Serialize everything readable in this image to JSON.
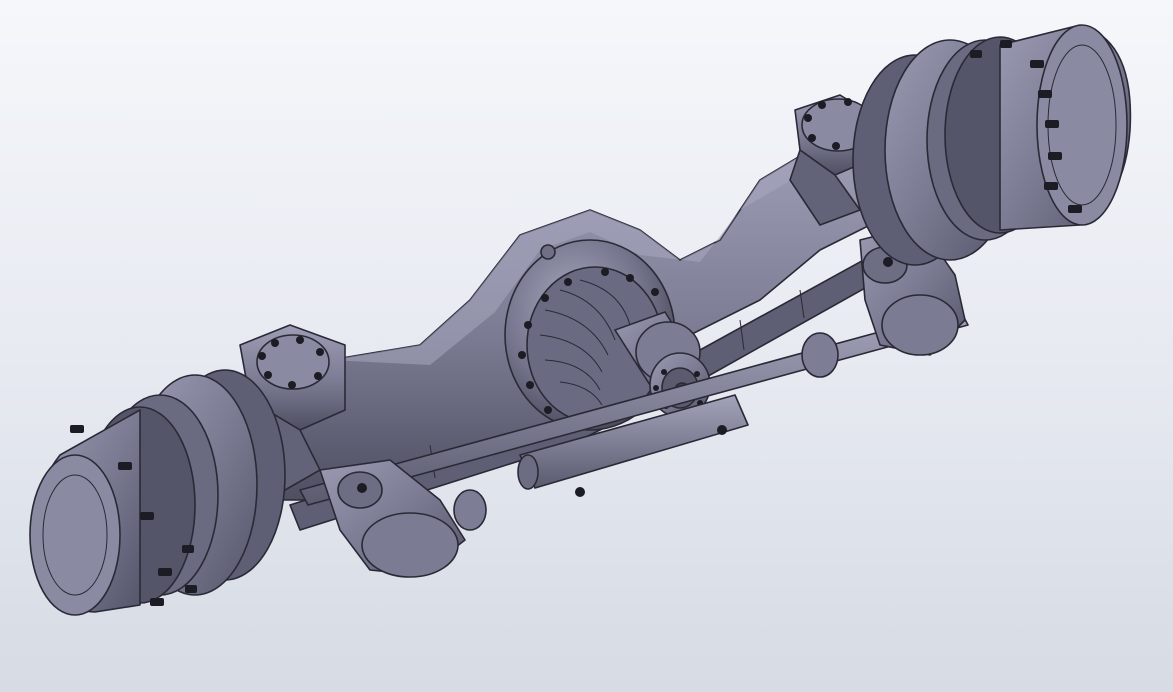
{
  "viewport": {
    "background_top": "#f5f7fb",
    "background_bottom": "#d6dbe4",
    "model_color": "#7b7b93",
    "model_shadow": "#4a4a5c",
    "edge_color": "#2a2a36"
  },
  "model": {
    "parts": [
      "left-hub",
      "right-hub",
      "axle-housing",
      "differential-carrier",
      "input-flange",
      "steering-tie-rod",
      "left-knuckle-arm",
      "right-knuckle-arm",
      "left-spring-pad",
      "right-spring-pad"
    ]
  }
}
